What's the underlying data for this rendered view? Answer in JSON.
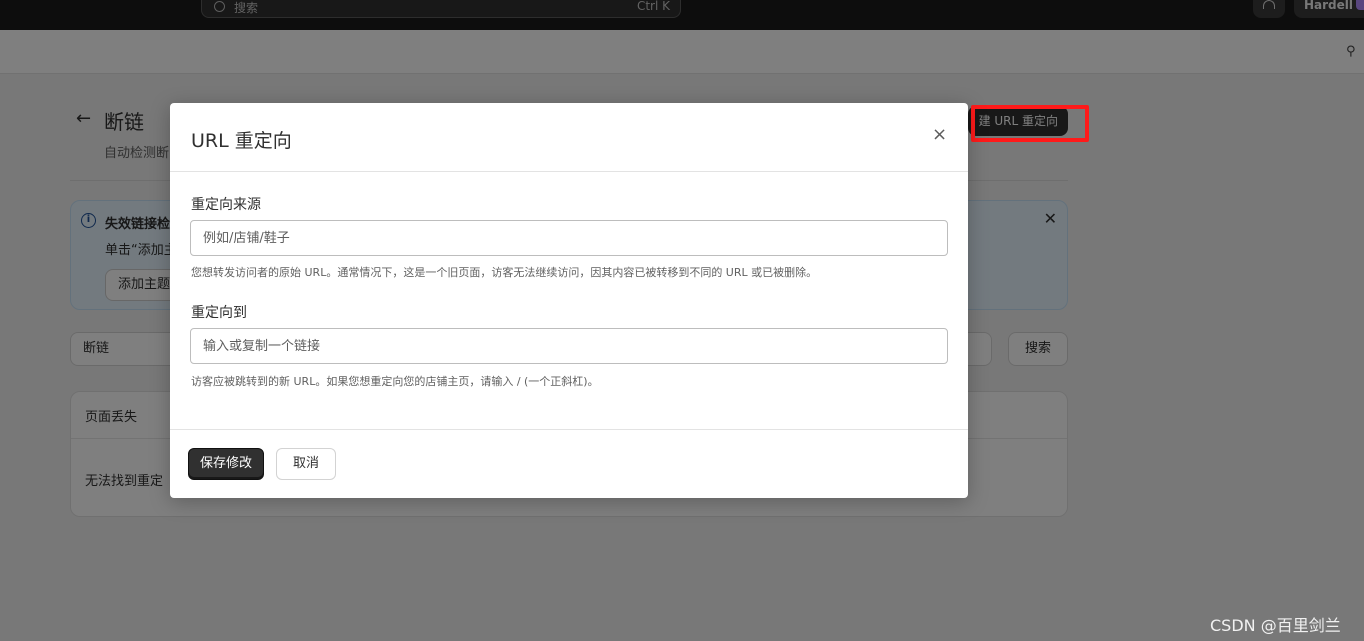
{
  "topbar": {
    "search_placeholder": "搜索",
    "search_shortcut": "Ctrl K",
    "user_name": "Hardell",
    "user_badge_color": "#b28cff"
  },
  "page": {
    "back_icon": "←",
    "title": "断链",
    "subtitle": "自动检测断",
    "create_button": "建 URL 重定向",
    "banner": {
      "title": "失效链接检",
      "text": "单击“添加主",
      "button": "添加主题",
      "close": "✕"
    },
    "filter_label": "断链",
    "search_button": "搜索",
    "card": {
      "header": "页面丢失",
      "empty_text": "无法找到重定"
    }
  },
  "modal": {
    "title": "URL 重定向",
    "close": "×",
    "source_label": "重定向来源",
    "source_placeholder": "例如/店铺/鞋子",
    "source_help": "您想转发访问者的原始 URL。通常情况下，这是一个旧页面，访客无法继续访问，因其内容已被转移到不同的 URL 或已被删除。",
    "target_label": "重定向到",
    "target_placeholder": "输入或复制一个链接",
    "target_help": "访客应被跳转到的新 URL。如果您想重定向您的店铺主页，请输入 / (一个正斜杠)。",
    "save_button": "保存修改",
    "cancel_button": "取消"
  },
  "annotation_color": "#ff1a1a",
  "watermark": "CSDN @百里剑兰"
}
